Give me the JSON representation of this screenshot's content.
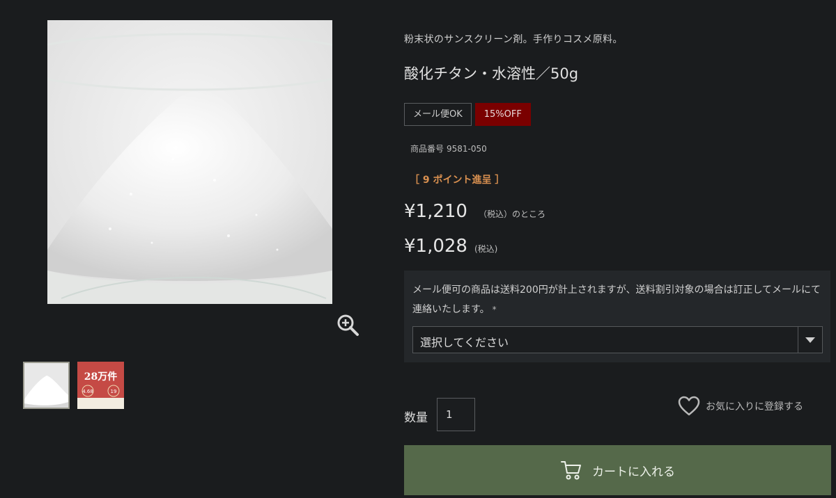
{
  "product": {
    "subtitle": "粉末状のサンスクリーン剤。手作りコスメ原料。",
    "title": "酸化チタン・水溶性／50g",
    "badges": {
      "mail": "メール便OK",
      "discount": "15%OFF"
    },
    "sku_label": "商品番号",
    "sku_value": "9581-050",
    "points": "［ 9 ポイント進呈 ］",
    "price_original": "¥1,210",
    "price_original_note": "（税込）のところ",
    "price_sale": "¥1,028",
    "price_sale_note": "(税込)"
  },
  "option": {
    "text": "メール便可の商品は送料200円が計上されますが、送料割引対象の場合は訂正してメールにて連絡いたします。",
    "required_mark": "*",
    "select_value": "選択してください"
  },
  "purchase": {
    "qty_label": "数量",
    "qty_value": "1",
    "favorite_label": "お気に入りに登録する",
    "cart_label": "カートに入れる"
  },
  "thumb2": {
    "line1": "28万件",
    "rating": "4.68",
    "count": "19"
  },
  "icons": {
    "zoom": "zoom-in-icon",
    "heart": "heart-icon",
    "cart": "cart-icon",
    "dropdown": "chevron-down-icon"
  },
  "colors": {
    "background": "#1a1c1e",
    "sale_badge": "#7a0000",
    "points": "#d99050",
    "cart_button": "#55694a"
  }
}
